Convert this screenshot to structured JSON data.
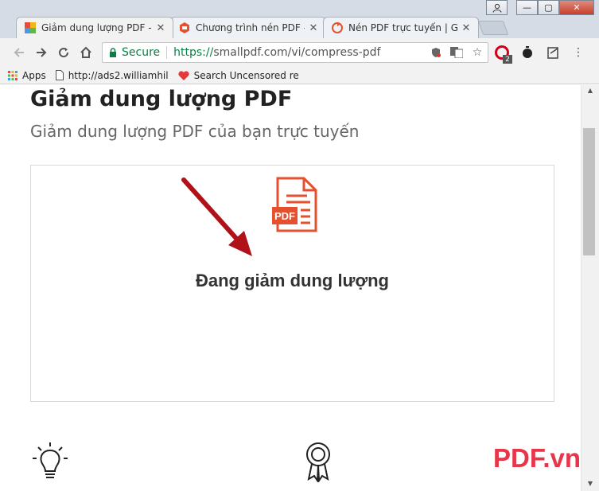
{
  "browser": {
    "tabs": [
      {
        "title": "Giảm dung lượng PDF - &",
        "active": true
      },
      {
        "title": "Chương trình nén PDF – ",
        "active": false
      },
      {
        "title": "Nén PDF trực tuyến | Giả",
        "active": false
      }
    ],
    "window_buttons": {
      "minimize": "—",
      "maximize": "▢",
      "close": "✕"
    },
    "address": {
      "secure_label": "Secure",
      "url_scheme": "https://",
      "url_rest": "smallpdf.com/vi/compress-pdf"
    },
    "bookmarks": [
      {
        "label": "Apps",
        "icon": "apps-grid-icon"
      },
      {
        "label": "http://ads2.williamhil",
        "icon": "page-icon"
      },
      {
        "label": "Search Uncensored re",
        "icon": "heart-icon"
      }
    ],
    "extension_badge": "2"
  },
  "page": {
    "title": "Giảm dung lượng PDF",
    "subtitle": "Giảm dung lượng PDF của bạn trực tuyến",
    "status": "Đang giảm dung lượng",
    "pdf_label": "PDF",
    "watermark": "PDF.vn"
  },
  "colors": {
    "accent": "#e5502e",
    "watermark": "#e8354a",
    "arrow": "#b0121a",
    "secure": "#0b8043"
  }
}
